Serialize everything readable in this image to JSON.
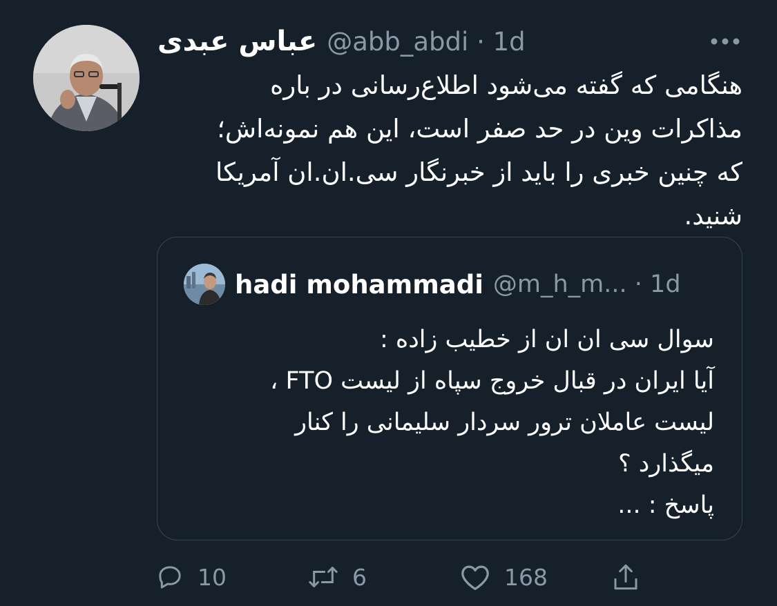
{
  "tweet": {
    "author_name": "عباس عبدی",
    "author_handle": "@abb_abdi",
    "time": "1d",
    "text": "هنگامی که گفته می‌شود اطلاع‌رسانی در باره\nمذاکرات وین در حد صفر است، این هم نمونه‌اش؛\nکه چنین خبری را باید از خبرنگار سی.ان.ان آمریکا\nشنید.",
    "more_icon": "more-dots-icon"
  },
  "quoted_tweet": {
    "author_name": "hadi mohammadi",
    "author_handle": "@m_h_m...",
    "time": "1d",
    "text": "سوال سی ان ان از خطیب زاده :\nآیا ایران در قبال خروج سپاه از لیست FTO ،\nلیست عاملان ترور سردار سلیمانی را کنار\nمیگذارد ؟\nپاسخ : ..."
  },
  "actions": {
    "reply_count": "10",
    "retweet_count": "6",
    "like_count": "168",
    "icons": [
      "reply-icon",
      "retweet-icon",
      "like-icon",
      "share-icon"
    ]
  },
  "colors": {
    "background": "#15202b",
    "secondary_text": "#8b98a5",
    "border": "#38444d"
  }
}
